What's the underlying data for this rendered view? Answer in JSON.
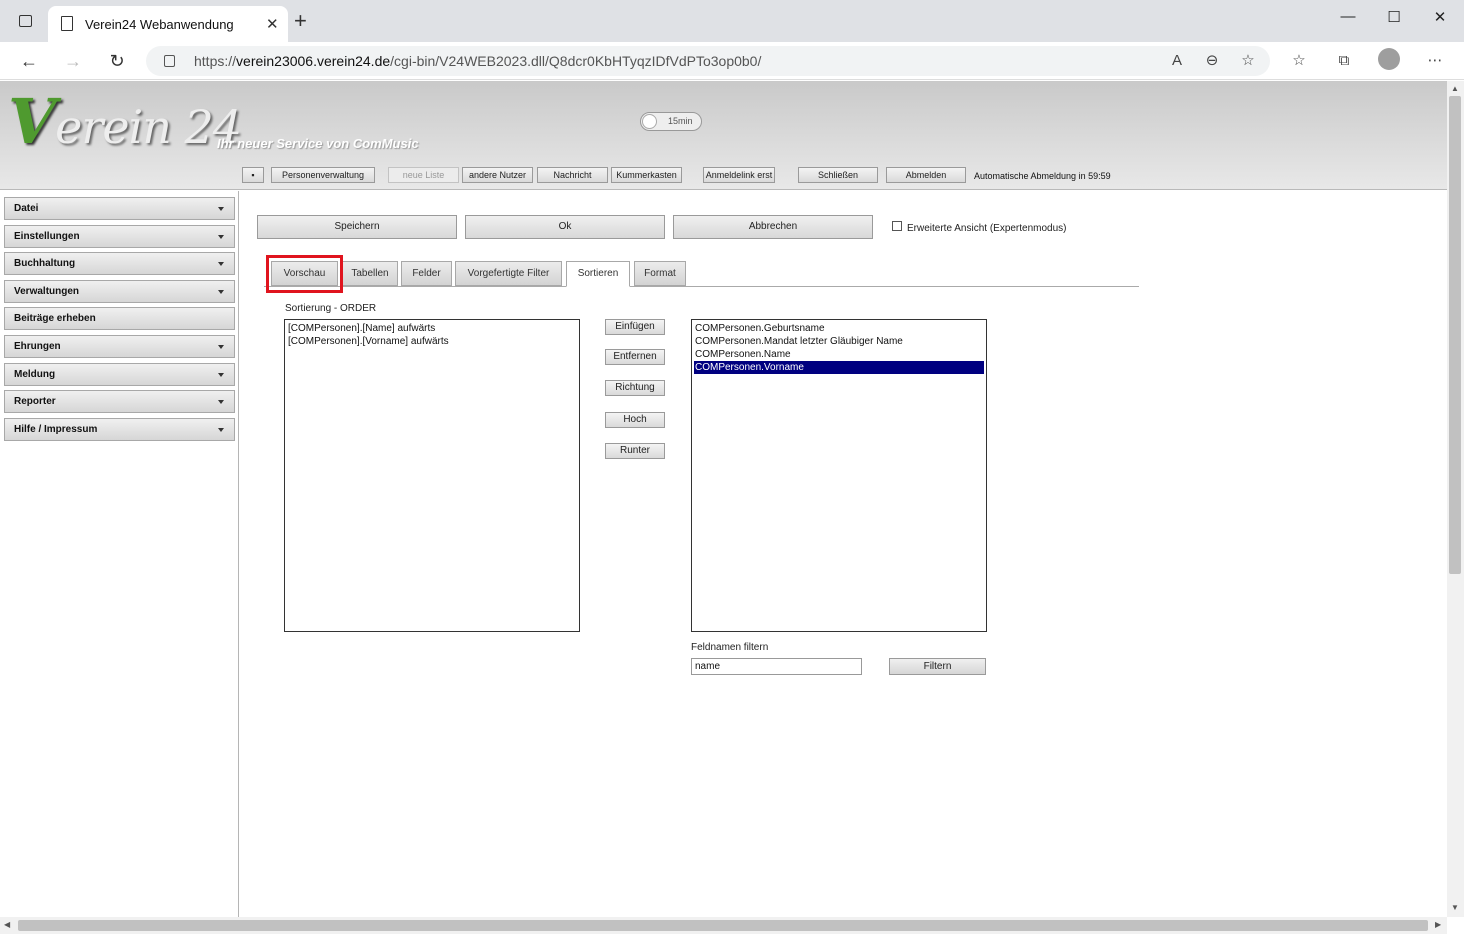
{
  "browser": {
    "tab_title": "Verein24 Webanwendung",
    "new_tab": "+",
    "url_host": "verein23006.verein24.de",
    "url_prefix": "https://",
    "url_path": "/cgi-bin/V24WEB2023.dll/Q8dcr0KbHTyqzIDfVdPTo3op0b0/"
  },
  "header": {
    "logo_v": "V",
    "logo_rest": "erein 24",
    "slogan": "Ihr neuer Service von ComMusic",
    "toggle_label": "15min"
  },
  "topmenu": {
    "square": "▪",
    "personenverwaltung": "Personenverwaltung",
    "neue_liste": "neue Liste",
    "andere_nutzer": "andere Nutzer",
    "nachricht": "Nachricht",
    "kummerkasten": "Kummerkasten",
    "anmeldelink": "Anmeldelink erst",
    "schliessen": "Schließen",
    "abmelden": "Abmelden",
    "auto_logout": "Automatische Abmeldung in 59:59"
  },
  "sidebar": {
    "items": [
      {
        "label": "Datei"
      },
      {
        "label": "Einstellungen"
      },
      {
        "label": "Buchhaltung"
      },
      {
        "label": "Verwaltungen"
      },
      {
        "label": "Beiträge erheben"
      },
      {
        "label": "Ehrungen"
      },
      {
        "label": "Meldung"
      },
      {
        "label": "Reporter"
      },
      {
        "label": "Hilfe / Impressum"
      }
    ]
  },
  "actions": {
    "speichern": "Speichern",
    "ok": "Ok",
    "abbrechen": "Abbrechen",
    "expert_label": "Erweiterte Ansicht (Expertenmodus)"
  },
  "tabs": {
    "vorschau": "Vorschau",
    "tabellen": "Tabellen",
    "felder": "Felder",
    "vorgefertigte_filter": "Vorgefertigte Filter",
    "sortieren": "Sortieren",
    "format": "Format"
  },
  "sort": {
    "label": "Sortierung - ORDER",
    "order_items": [
      "[COMPersonen].[Name] aufwärts",
      "[COMPersonen].[Vorname] aufwärts"
    ],
    "buttons": {
      "einfuegen": "Einfügen",
      "entfernen": "Entfernen",
      "richtung": "Richtung",
      "hoch": "Hoch",
      "runter": "Runter"
    },
    "fields": [
      "COMPersonen.Geburtsname",
      "COMPersonen.Mandat letzter Gläubiger Name",
      "COMPersonen.Name",
      "COMPersonen.Vorname"
    ],
    "selected_field": "COMPersonen.Vorname",
    "filter_label": "Feldnamen filtern",
    "filter_value": "name",
    "filter_button": "Filtern"
  }
}
